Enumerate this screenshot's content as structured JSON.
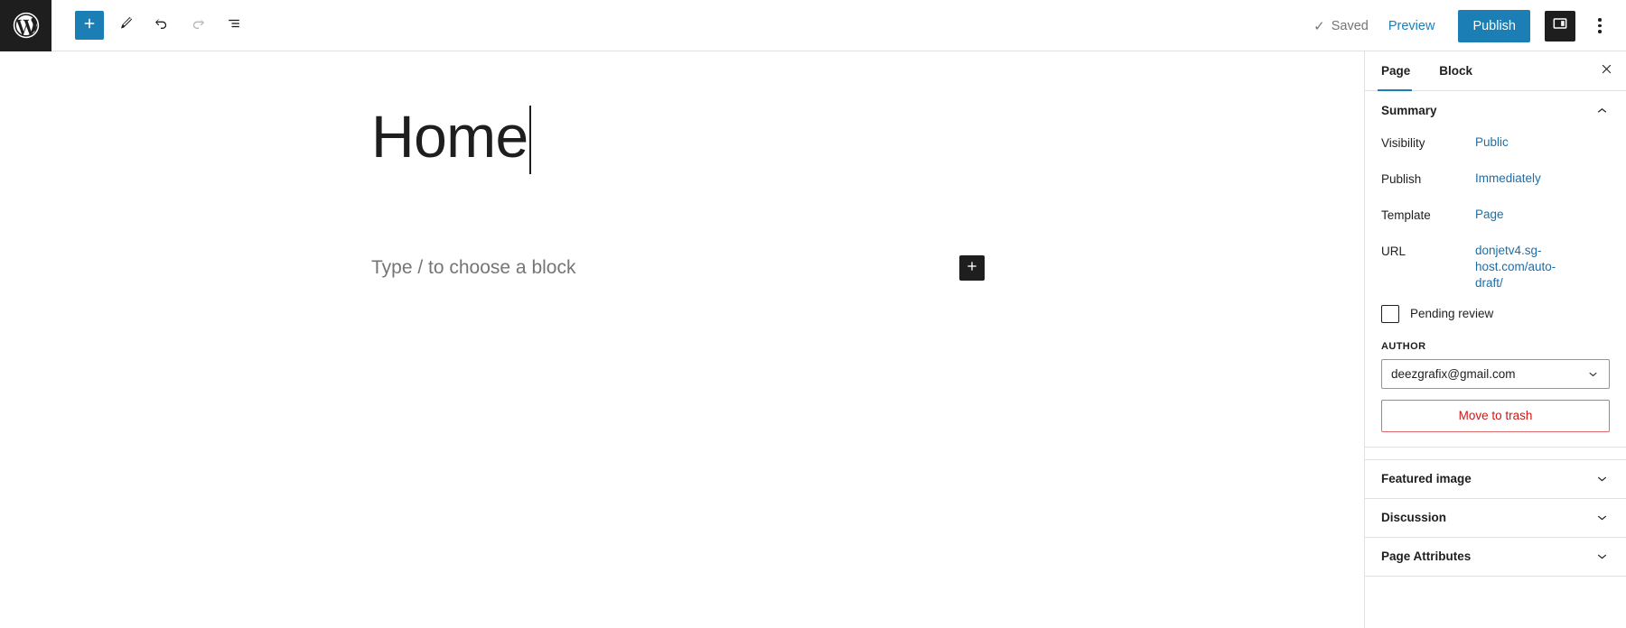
{
  "topbar": {
    "logo_icon": "wordpress-logo-icon",
    "tools": [
      {
        "name": "add-block-toggle",
        "icon": "plus-icon",
        "state": "active"
      },
      {
        "name": "edit-tools",
        "icon": "pencil-icon",
        "state": "default"
      },
      {
        "name": "undo",
        "icon": "undo-arrow-icon",
        "state": "default"
      },
      {
        "name": "redo",
        "icon": "redo-arrow-icon",
        "state": "disabled"
      },
      {
        "name": "list-view",
        "icon": "list-view-icon",
        "state": "default"
      }
    ],
    "saved_label": "Saved",
    "saved_check": "✓",
    "preview_label": "Preview",
    "publish_label": "Publish",
    "sidebar_toggle_icon": "sidebar-panel-icon",
    "options_icon": "three-dots-vertical-icon",
    "accent_color": "#1b7eb5",
    "annotation_color": "#f4364c"
  },
  "editor": {
    "title": "Home",
    "block_placeholder": "Type / to choose a block",
    "add_block_icon": "plus-icon"
  },
  "sidebar": {
    "tabs": [
      {
        "label": "Page",
        "active": true
      },
      {
        "label": "Block",
        "active": false
      }
    ],
    "close_icon": "close-icon",
    "summary": {
      "title": "Summary",
      "chevron": "chevron-up-icon",
      "rows": [
        {
          "label": "Visibility",
          "value": "Public"
        },
        {
          "label": "Publish",
          "value": "Immediately"
        },
        {
          "label": "Template",
          "value": "Page"
        },
        {
          "label": "URL",
          "value": "donjetv4.sg-host.com/auto-draft/"
        }
      ],
      "pending_review_label": "Pending review",
      "pending_review_checked": false,
      "author_label": "AUTHOR",
      "author_value": "deezgrafix@gmail.com",
      "author_chevron": "chevron-down-icon",
      "trash_label": "Move to trash",
      "trash_color": "#cc1818"
    },
    "panels": [
      {
        "title": "Featured image",
        "chevron": "chevron-down-icon"
      },
      {
        "title": "Discussion",
        "chevron": "chevron-down-icon"
      },
      {
        "title": "Page Attributes",
        "chevron": "chevron-down-icon"
      }
    ]
  }
}
